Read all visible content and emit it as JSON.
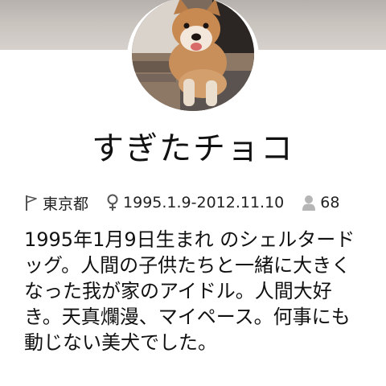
{
  "profile": {
    "name": "すぎたチョコ",
    "location": "東京都",
    "dates": "1995.1.9-2012.11.10",
    "followers": "68",
    "bio": "1995年1月9日生まれ のシェルタードッグ。人間の子供たちと一緒に大きくなった我が家のアイドル。人間大好き。天真爛漫、マイペース。何事にも動じない美犬でした。"
  },
  "icons": {
    "location": "flag-icon",
    "gender": "female-icon",
    "followers": "person-icon"
  },
  "colors": {
    "text": "#111111",
    "icon": "#555555",
    "person_icon": "#b5b5b5"
  }
}
